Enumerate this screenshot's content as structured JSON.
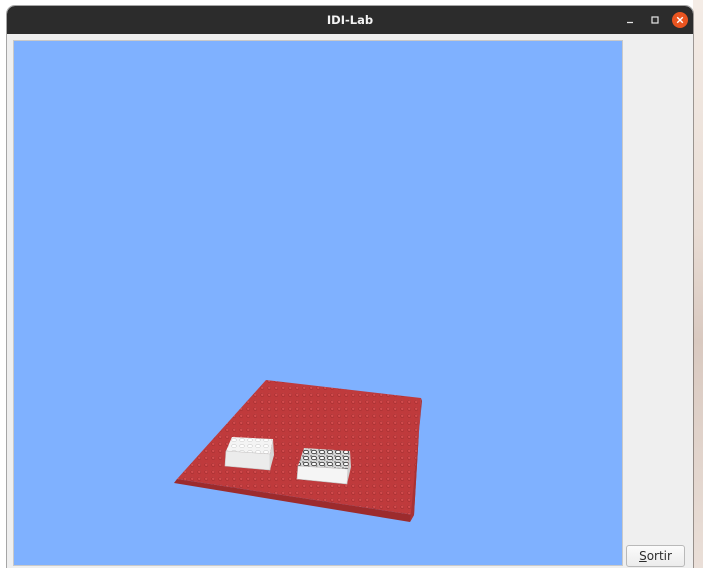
{
  "window": {
    "title": "IDI-Lab"
  },
  "controls": {
    "minimize_icon": "minimize-icon",
    "maximize_icon": "maximize-icon",
    "close_icon": "close-icon",
    "close_color": "#e95420"
  },
  "scene": {
    "background_color": "#7fb1ff",
    "baseplate_color": "#c0393b",
    "bricks": [
      {
        "name": "white-brick",
        "color": "#ffffff"
      },
      {
        "name": "speckled-brick",
        "color": "#ffffff"
      }
    ]
  },
  "exit_button": {
    "mnemonic": "S",
    "rest": "ortir"
  }
}
